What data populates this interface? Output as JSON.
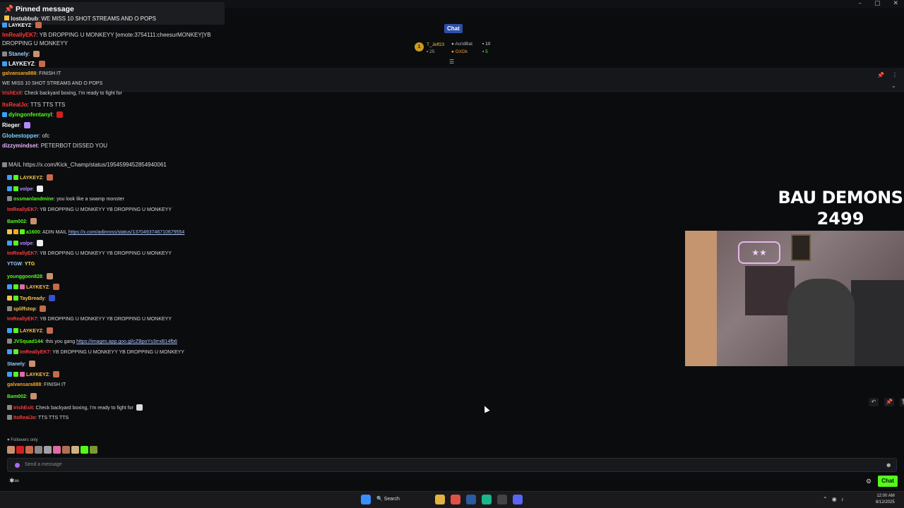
{
  "window": {
    "controls": [
      "–",
      "▢",
      "✕"
    ]
  },
  "pinned": {
    "title": "Pinned message",
    "user": "lostubbub",
    "text": "WE MISS 10 SHOT STREAMS AND O POPS"
  },
  "header": {
    "chat_label": "Chat"
  },
  "leaderboard": {
    "rank": "1",
    "user1": "T_Jeff23",
    "user1_count": "25",
    "user2": "AcridBat",
    "user2_count": "10",
    "user3": "GXDk",
    "user3_count": "5"
  },
  "messages": [
    {
      "user": "LAYKEYZ",
      "text": "",
      "color": "#ffffff"
    },
    {
      "user": "ImReallyEK7",
      "text": "YB DROPPING U MONKEYY  [emote:3754111:cheesurMONKEY]YB",
      "color": "#ff3b3b"
    },
    {
      "user": "",
      "text": "DROPPING U MONKEYY",
      "color": "#ffffff"
    },
    {
      "user": "Stanely",
      "text": "",
      "color": "#9ad0ff"
    },
    {
      "user": "LAYKEYZ",
      "text": "",
      "color": "#ffffff"
    },
    {
      "user": "galvansara888",
      "text": "FINISH IT",
      "color": "#f5a623"
    },
    {
      "user": "",
      "text": "WE MISS 10 SHOT STREAMS AND O POPS",
      "color": "#ffffff"
    },
    {
      "user": "IrishExit",
      "text": "Check backyard boxing, I'm ready to fight for",
      "color": "#ff3b3b"
    },
    {
      "user": "ItsRealJo",
      "text": "TTS TTS TTS",
      "color": "#ff3b3b"
    },
    {
      "user": "dyingonfentanyl",
      "text": "",
      "color": "#53fc18"
    },
    {
      "user": "Rieger",
      "text": "",
      "color": "#ffffff"
    },
    {
      "user": "Globestopper",
      "text": "ofc",
      "color": "#7ad3ff"
    },
    {
      "user": "dizzymindset",
      "text": "PETERBOT DISSED YOU",
      "color": "#e8b0ff"
    },
    {
      "user": "",
      "text": "https://x.com/Kick_Champ/status/1954599452854940061",
      "color": "#ffffff"
    }
  ],
  "chat_lines": [
    {
      "user": "LAYKEYZ",
      "text": "",
      "color": "#f5c24b"
    },
    {
      "user": "volpe",
      "text": "",
      "color": "#b48bff"
    },
    {
      "user": "ossmanlandmine",
      "text": "you look like a swamp monster",
      "color": "#53fc18"
    },
    {
      "user": "ImReallyEK7",
      "text": "YB DROPPING U MONKEYY          YB DROPPING U MONKEYY",
      "color": "#ff3b3b"
    },
    {
      "user": "Bam002",
      "text": "",
      "color": "#53fc18"
    },
    {
      "user": "a1600",
      "text": "ADIN MAIL",
      "link": "https://x.com/adinross/status/1370493746710679554",
      "color": "#53fc18"
    },
    {
      "user": "volpe",
      "text": "",
      "color": "#b48bff"
    },
    {
      "user": "ImReallyEK7",
      "text": "YB DROPPING U MONKEYY          YB DROPPING U MONKEYY",
      "color": "#ff3b3b"
    },
    {
      "user": "YTGW",
      "text": "YTG",
      "color": "#9ad0ff"
    },
    {
      "user": "younggoon828",
      "text": "",
      "color": "#53fc18"
    },
    {
      "user": "LAYKEYZ",
      "text": "",
      "color": "#f5c24b"
    },
    {
      "user": "TayBready",
      "text": "",
      "color": "#f5c24b"
    },
    {
      "user": "spliffstop",
      "text": "",
      "color": "#f5c24b"
    },
    {
      "user": "ImReallyEK7",
      "text": "YB DROPPING U MONKEYY          YB DROPPING U MONKEYY",
      "color": "#ff3b3b"
    },
    {
      "user": "LAYKEYZ",
      "text": "",
      "color": "#f5c24b"
    },
    {
      "user": "JVSquad144",
      "text": "this you gang",
      "link": "https://images.app.goo.gl/cZBpoYs3rrxB14fb6",
      "color": "#53fc18"
    },
    {
      "user": "ImReallyEK7",
      "text": "YB DROPPING U MONKEYY          YB DROPPING U MONKEYY",
      "color": "#ff3b3b"
    },
    {
      "user": "Stanely",
      "text": "",
      "color": "#9ad0ff"
    },
    {
      "user": "LAYKEYZ",
      "text": "",
      "color": "#f5c24b"
    },
    {
      "user": "galvansara888",
      "text": "FINISH IT",
      "color": "#f5a623"
    },
    {
      "user": "Bam002",
      "text": "",
      "color": "#53fc18"
    },
    {
      "user": "IrishExit",
      "text": "Check backyard boxing, I'm ready to fight for",
      "color": "#ff3b3b"
    },
    {
      "user": "ItsRealJo",
      "text": "TTS TTS TTS",
      "color": "#ff3b3b"
    }
  ],
  "overlay": {
    "line1": "BAU DEMONS",
    "line2": "2499"
  },
  "webcam": {
    "neon_text": "★★"
  },
  "followers": {
    "label": "Followers only"
  },
  "input": {
    "placeholder": "Send a message"
  },
  "footer": {
    "chat_button": "Chat"
  },
  "taskbar": {
    "search": "Search",
    "time": "12:00 AM",
    "date": "8/12/2025"
  }
}
